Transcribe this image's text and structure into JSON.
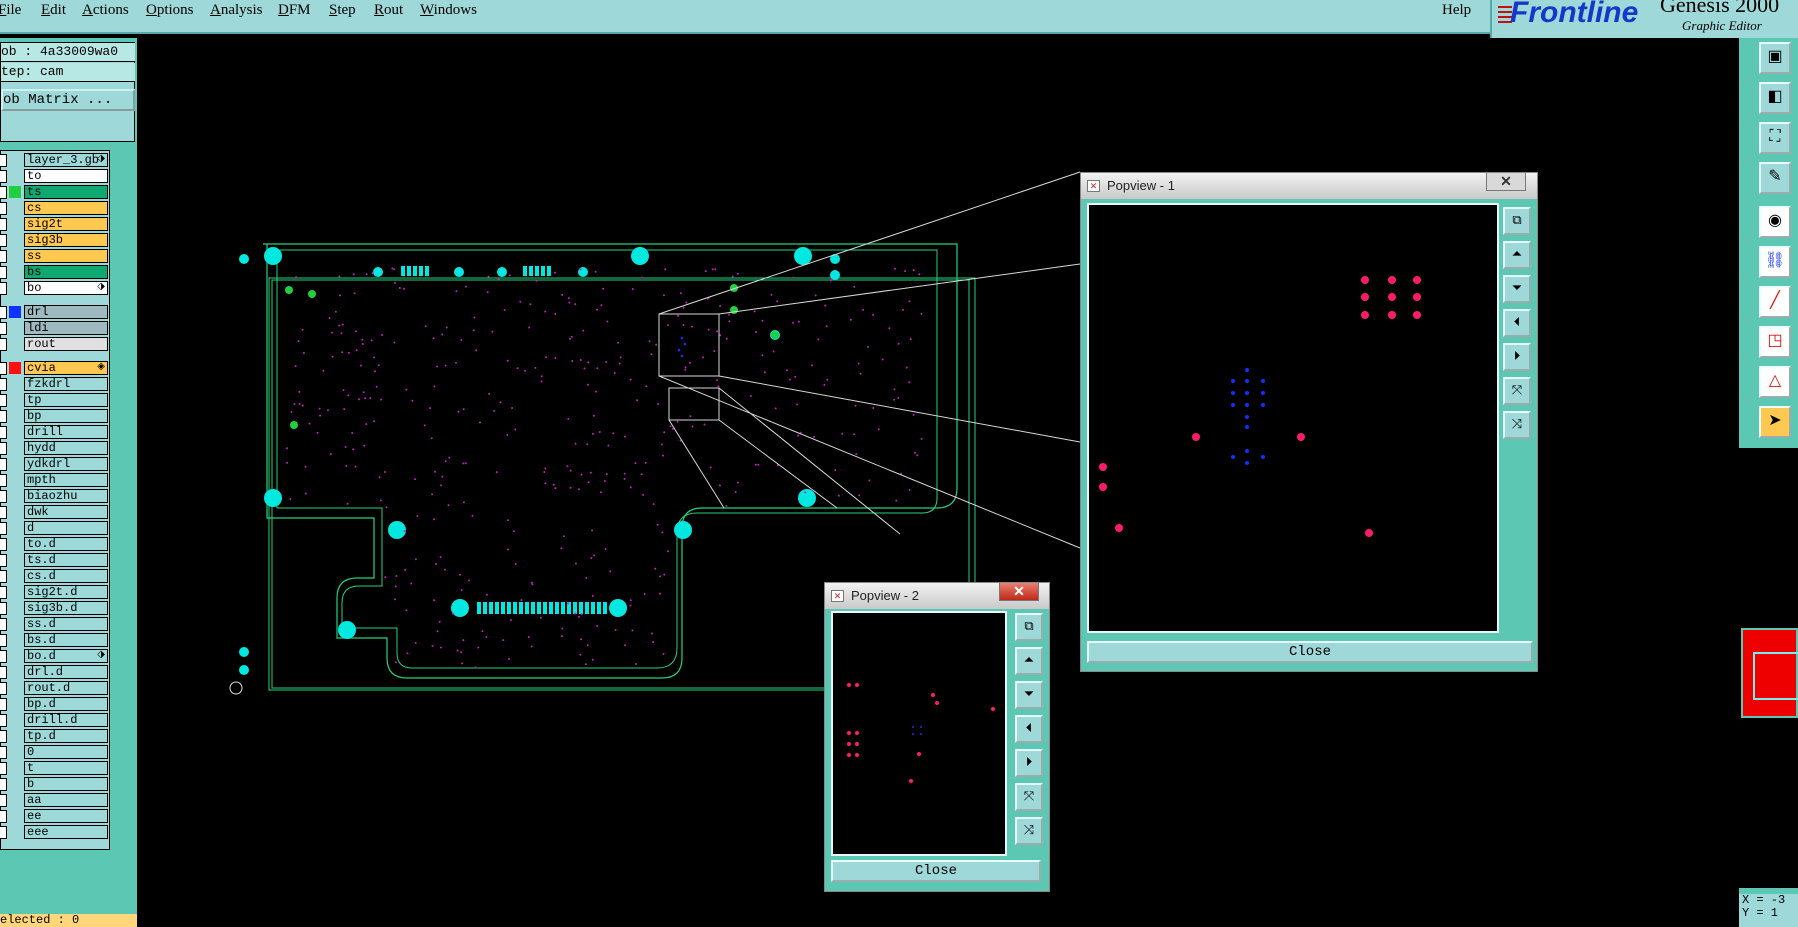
{
  "menu": {
    "items": [
      "File",
      "Edit",
      "Actions",
      "Options",
      "Analysis",
      "DFM",
      "Step",
      "Rout",
      "Windows"
    ],
    "help": "Help"
  },
  "brand": {
    "logo": "Frontline",
    "title": "Genesis 2000",
    "subtitle": "Graphic Editor"
  },
  "job": {
    "job_line": "ob : 4a33009wa0",
    "step_line": "tep: cam",
    "matrix_button": "ob Matrix ..."
  },
  "layers": [
    {
      "name": "layer_3.gb",
      "color": "#9ed8d8",
      "bg": "#9ed8d8",
      "flag": "⬗"
    },
    {
      "name": "to",
      "color": "#9ed8d8",
      "bg": "#ffffff",
      "flag": ""
    },
    {
      "name": "ts",
      "color": "#20d040",
      "bg": "#10a870",
      "flag": ""
    },
    {
      "name": "cs",
      "color": "#9ed8d8",
      "bg": "#ffc850",
      "flag": ""
    },
    {
      "name": "sig2t",
      "color": "#9ed8d8",
      "bg": "#ffc850",
      "flag": ""
    },
    {
      "name": "sig3b",
      "color": "#9ed8d8",
      "bg": "#ffc850",
      "flag": ""
    },
    {
      "name": "ss",
      "color": "#9ed8d8",
      "bg": "#ffc850",
      "flag": ""
    },
    {
      "name": "bs",
      "color": "#9ed8d8",
      "bg": "#10a870",
      "flag": ""
    },
    {
      "name": "bo",
      "color": "#9ed8d8",
      "bg": "#ffffff",
      "flag": "⬗"
    },
    {
      "name": "drl",
      "color": "#1030ff",
      "bg": "#a0b8c0",
      "flag": ""
    },
    {
      "name": "ldi",
      "color": "#9ed8d8",
      "bg": "#a0b8c0",
      "flag": ""
    },
    {
      "name": "rout",
      "color": "#9ed8d8",
      "bg": "#e0e0e0",
      "flag": ""
    },
    {
      "name": "cvia",
      "color": "#ff1010",
      "bg": "#ffc850",
      "flag": "◈"
    },
    {
      "name": "fzkdrl",
      "color": "#9ed8d8",
      "bg": "#9ed8d8",
      "flag": ""
    },
    {
      "name": "tp",
      "color": "#9ed8d8",
      "bg": "#9ed8d8",
      "flag": ""
    },
    {
      "name": "bp",
      "color": "#9ed8d8",
      "bg": "#9ed8d8",
      "flag": ""
    },
    {
      "name": "drill",
      "color": "#9ed8d8",
      "bg": "#9ed8d8",
      "flag": ""
    },
    {
      "name": "hydd",
      "color": "#9ed8d8",
      "bg": "#9ed8d8",
      "flag": ""
    },
    {
      "name": "ydkdrl",
      "color": "#9ed8d8",
      "bg": "#9ed8d8",
      "flag": ""
    },
    {
      "name": "mpth",
      "color": "#9ed8d8",
      "bg": "#9ed8d8",
      "flag": ""
    },
    {
      "name": "biaozhu",
      "color": "#9ed8d8",
      "bg": "#9ed8d8",
      "flag": ""
    },
    {
      "name": "dwk",
      "color": "#9ed8d8",
      "bg": "#9ed8d8",
      "flag": ""
    },
    {
      "name": "d",
      "color": "#9ed8d8",
      "bg": "#9ed8d8",
      "flag": ""
    },
    {
      "name": "to.d",
      "color": "#9ed8d8",
      "bg": "#9ed8d8",
      "flag": ""
    },
    {
      "name": "ts.d",
      "color": "#9ed8d8",
      "bg": "#9ed8d8",
      "flag": ""
    },
    {
      "name": "cs.d",
      "color": "#9ed8d8",
      "bg": "#9ed8d8",
      "flag": ""
    },
    {
      "name": "sig2t.d",
      "color": "#9ed8d8",
      "bg": "#9ed8d8",
      "flag": ""
    },
    {
      "name": "sig3b.d",
      "color": "#9ed8d8",
      "bg": "#9ed8d8",
      "flag": ""
    },
    {
      "name": "ss.d",
      "color": "#9ed8d8",
      "bg": "#9ed8d8",
      "flag": ""
    },
    {
      "name": "bs.d",
      "color": "#9ed8d8",
      "bg": "#9ed8d8",
      "flag": ""
    },
    {
      "name": "bo.d",
      "color": "#9ed8d8",
      "bg": "#9ed8d8",
      "flag": "⬗"
    },
    {
      "name": "drl.d",
      "color": "#9ed8d8",
      "bg": "#9ed8d8",
      "flag": ""
    },
    {
      "name": "rout.d",
      "color": "#9ed8d8",
      "bg": "#9ed8d8",
      "flag": ""
    },
    {
      "name": "bp.d",
      "color": "#9ed8d8",
      "bg": "#9ed8d8",
      "flag": ""
    },
    {
      "name": "drill.d",
      "color": "#9ed8d8",
      "bg": "#9ed8d8",
      "flag": ""
    },
    {
      "name": "tp.d",
      "color": "#9ed8d8",
      "bg": "#9ed8d8",
      "flag": ""
    },
    {
      "name": "0",
      "color": "#9ed8d8",
      "bg": "#9ed8d8",
      "flag": ""
    },
    {
      "name": "t",
      "color": "#9ed8d8",
      "bg": "#9ed8d8",
      "flag": ""
    },
    {
      "name": "b",
      "color": "#9ed8d8",
      "bg": "#9ed8d8",
      "flag": ""
    },
    {
      "name": "aa",
      "color": "#9ed8d8",
      "bg": "#9ed8d8",
      "flag": ""
    },
    {
      "name": "ee",
      "color": "#9ed8d8",
      "bg": "#9ed8d8",
      "flag": ""
    },
    {
      "name": "eee",
      "color": "#9ed8d8",
      "bg": "#9ed8d8",
      "flag": ""
    }
  ],
  "status": {
    "selected": "elected : 0"
  },
  "coords": {
    "x": "X = -3",
    "y": "Y = 1"
  },
  "popview1": {
    "title": "Popview - 1",
    "close_label": "Close",
    "close_x": "✕"
  },
  "popview2": {
    "title": "Popview - 2",
    "close_label": "Close",
    "close_x": "✕"
  },
  "toolbar_icons": [
    "home-view-icon",
    "zoom-icon",
    "fit-icon",
    "palette-icon",
    "snap-icon",
    "connect-icon",
    "line-icon",
    "add-pad-icon",
    "polygon-icon",
    "pointer-icon"
  ],
  "colors": {
    "board_outline": "#29d07a",
    "pad": "#00e8e0",
    "via": "#c020c0",
    "highlight_pad": "#ff1a6a",
    "blue_drill": "#1030ff"
  }
}
